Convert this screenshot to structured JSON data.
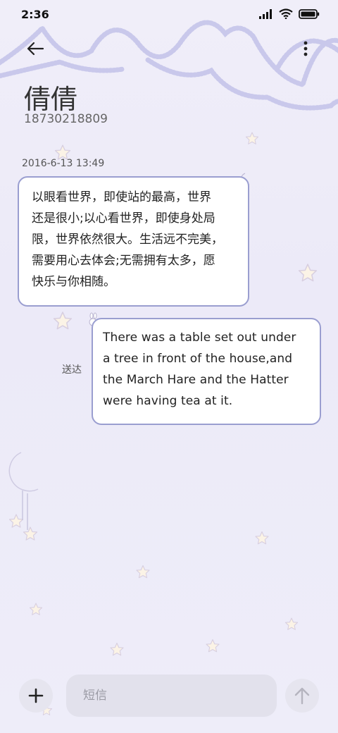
{
  "status_bar": {
    "time": "2:36",
    "icons": [
      "signal-icon",
      "wifi-icon",
      "battery-icon"
    ]
  },
  "header": {
    "back_icon": "back-arrow-icon",
    "more_icon": "more-vertical-icon",
    "contact_name": "倩倩",
    "contact_number": "18730218809"
  },
  "conversation": {
    "timestamp": "2016-6-13 13:49",
    "incoming": {
      "lines": [
        "以眼看世界，即使站的最高，世界",
        "还是很小;以心看世界，即使身处局",
        "限，世界依然很大。生活远不完美，",
        "需要用心去体会;无需拥有太多，愿",
        "快乐与你相随。"
      ]
    },
    "outgoing": {
      "lines": [
        "There was a table set out under",
        "a tree in front of the house,and",
        "the March Hare and the Hatter",
        "were having tea at it."
      ],
      "status": "送达"
    }
  },
  "composer": {
    "add_icon": "plus-icon",
    "placeholder": "短信",
    "value": "",
    "send_icon": "send-arrow-icon"
  },
  "colors": {
    "bubble_border": "#9a9ed0",
    "decor_lilac": "#c5c5ea",
    "star_fill": "#fbf3e6",
    "moon_fill": "#f5ede0"
  }
}
